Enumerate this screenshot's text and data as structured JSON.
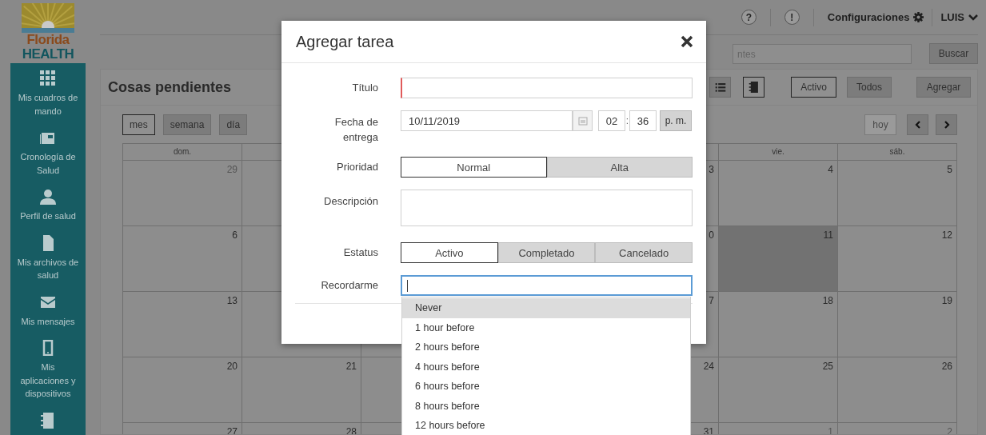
{
  "logo": {
    "word1": "Florida",
    "word2": "HEALTH"
  },
  "sidebar": {
    "items": [
      {
        "kind": "labeled",
        "label": "Mis cuadros de mando"
      },
      {
        "kind": "labeled",
        "label": "Cronología de Salud"
      },
      {
        "kind": "labeled",
        "label": "Perfil de salud"
      },
      {
        "kind": "labeled",
        "label": "Mis archivos de salud"
      },
      {
        "kind": "labeled",
        "label": "Mis mensajes"
      },
      {
        "kind": "labeled",
        "label": "Mis aplicaciones y dispositivos"
      },
      {
        "kind": "icon_only"
      }
    ]
  },
  "top_bar": {
    "help": "?",
    "alerts": "!",
    "settings": "Configuraciones",
    "user": "LUIS"
  },
  "search": {
    "placeholder": "ntes",
    "button": "Buscar"
  },
  "panel": {
    "title": "Cosas pendientes",
    "view_icons": [
      {
        "selected": false
      },
      {
        "selected": true
      }
    ],
    "filters": [
      {
        "label": "Activo",
        "selected": true
      },
      {
        "label": "Todos",
        "selected": false
      }
    ],
    "add_button": "Agregar",
    "views": [
      {
        "label": "mes",
        "selected": true
      },
      {
        "label": "semana",
        "selected": false
      },
      {
        "label": "día",
        "selected": false
      }
    ],
    "today_button": {
      "label": "hoy",
      "disabled": true
    }
  },
  "calendar": {
    "weekdays": [
      "dom.",
      "vie.",
      "sáb."
    ],
    "rows": [
      [
        {
          "day": "29",
          "other_month": true,
          "today": false
        },
        null,
        null,
        null,
        {
          "day": "3",
          "other_month": false,
          "today": false
        },
        {
          "day": "4",
          "other_month": false,
          "today": false
        },
        {
          "day": "5",
          "other_month": false,
          "today": false
        }
      ],
      [
        {
          "day": "6",
          "other_month": false,
          "today": false
        },
        null,
        null,
        null,
        {
          "day": "0",
          "other_month": false,
          "today": false
        },
        {
          "day": "11",
          "other_month": false,
          "today": true
        },
        {
          "day": "12",
          "other_month": false,
          "today": false
        }
      ],
      [
        {
          "day": "13",
          "other_month": false,
          "today": false
        },
        null,
        null,
        null,
        {
          "day": "7",
          "other_month": false,
          "today": false
        },
        {
          "day": "18",
          "other_month": false,
          "today": false
        },
        {
          "day": "19",
          "other_month": false,
          "today": false
        }
      ],
      [
        {
          "day": "20",
          "other_month": false,
          "today": false
        },
        {
          "day": "21",
          "other_month": false,
          "today": false
        },
        null,
        null,
        {
          "day": "24",
          "other_month": false,
          "today": false
        },
        {
          "day": "25",
          "other_month": false,
          "today": false
        },
        {
          "day": "26",
          "other_month": false,
          "today": false
        }
      ],
      [
        {
          "day": "27",
          "other_month": false,
          "today": false
        },
        {
          "day": "28",
          "other_month": false,
          "today": false
        },
        null,
        null,
        {
          "day": "31",
          "other_month": false,
          "today": false
        },
        {
          "day": "1",
          "other_month": true,
          "today": false
        },
        {
          "day": "2",
          "other_month": true,
          "today": false
        }
      ]
    ]
  },
  "dialog": {
    "title": "Agregar tarea",
    "fields": [
      {
        "kind": "text",
        "label": "Título",
        "invalid": true,
        "focused": false
      },
      {
        "kind": "datetime",
        "label": "Fecha de entrega",
        "date": "10/11/2019",
        "hour": "02",
        "separator": ":",
        "minute": "36",
        "meridiem": "p. m."
      },
      {
        "kind": "segmented",
        "label": "Prioridad",
        "options": [
          {
            "label": "Normal",
            "selected": true
          },
          {
            "label": "Alta",
            "selected": false
          }
        ]
      },
      {
        "kind": "textarea",
        "label": "Descripción"
      },
      {
        "kind": "segmented",
        "label": "Estatus",
        "options": [
          {
            "label": "Activo",
            "selected": true
          },
          {
            "label": "Completado",
            "selected": false
          },
          {
            "label": "Cancelado",
            "selected": false
          }
        ]
      },
      {
        "kind": "text",
        "label": "Recordarme",
        "invalid": false,
        "focused": true
      }
    ]
  },
  "reminder_options": [
    {
      "label": "Never",
      "selected": true
    },
    {
      "label": "1 hour before",
      "selected": false
    },
    {
      "label": "2 hours before",
      "selected": false
    },
    {
      "label": "4 hours before",
      "selected": false
    },
    {
      "label": "6 hours before",
      "selected": false
    },
    {
      "label": "8 hours before",
      "selected": false
    },
    {
      "label": "12 hours before",
      "selected": false
    }
  ]
}
